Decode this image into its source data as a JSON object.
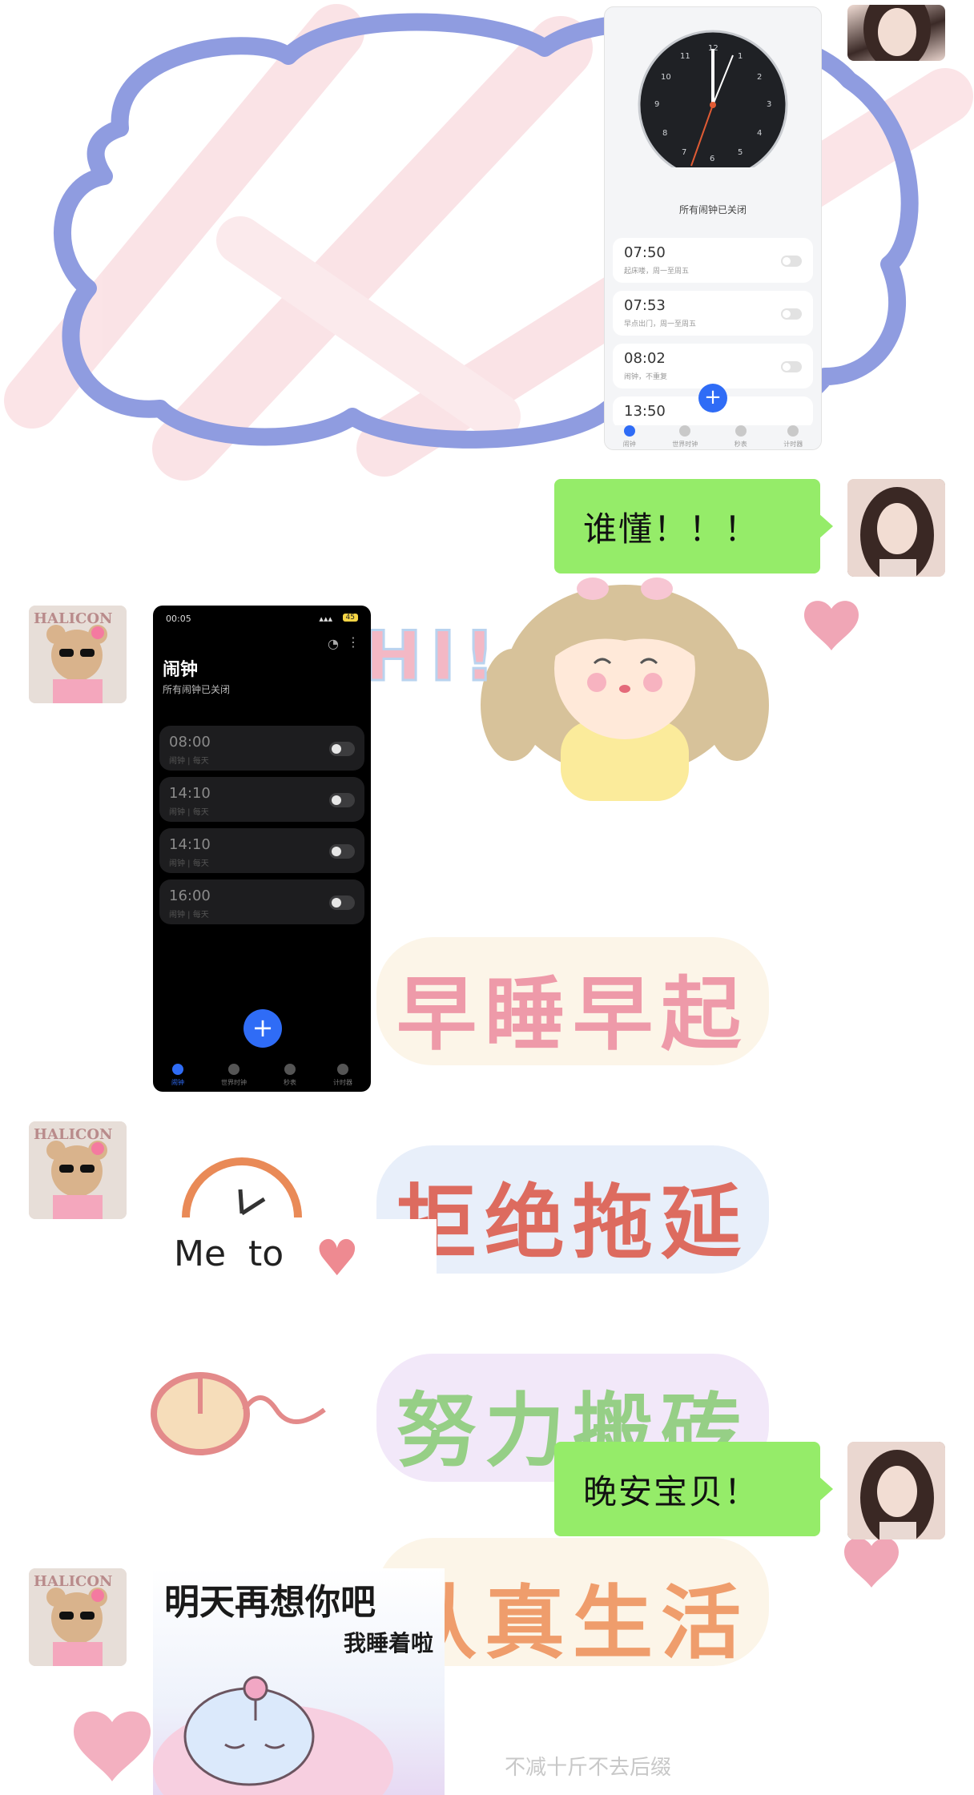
{
  "chat": {
    "messages": [
      {
        "from": "me",
        "type": "image",
        "name": "light-clock-screenshot"
      },
      {
        "from": "me",
        "type": "text",
        "text": "谁懂！！！"
      },
      {
        "from": "other",
        "type": "image",
        "name": "dark-clock-screenshot"
      },
      {
        "from": "other",
        "type": "sticker",
        "name": "morning-sticker"
      },
      {
        "from": "me",
        "type": "text",
        "text": "晚安宝贝！"
      },
      {
        "from": "other",
        "type": "sticker",
        "name": "goodnight-sticker"
      }
    ]
  },
  "bubbles": {
    "msg1": "谁懂！！！",
    "msg2": "晚安宝贝！"
  },
  "light_phone": {
    "caption": "所有闹钟已关闭",
    "dial_numbers": [
      "12",
      "1",
      "2",
      "3",
      "4",
      "5",
      "6",
      "7",
      "8",
      "9",
      "10",
      "11"
    ],
    "alarms": [
      {
        "time": "07:50",
        "sub": "起床喽，周一至周五"
      },
      {
        "time": "07:53",
        "sub": "早点出门，周一至周五"
      },
      {
        "time": "08:02",
        "sub": "闹钟，不重复"
      },
      {
        "time": "13:50",
        "sub": ""
      }
    ],
    "tabs": [
      "闹钟",
      "世界时钟",
      "秒表",
      "计时器"
    ]
  },
  "dark_phone": {
    "status_time": "00:05",
    "battery": "45",
    "title": "闹钟",
    "subtitle": "所有闹钟已关闭",
    "alarms": [
      {
        "time": "08:00",
        "sub": "闹钟 | 每天"
      },
      {
        "time": "14:10",
        "sub": "闹钟 | 每天"
      },
      {
        "time": "14:10",
        "sub": "闹钟 | 每天"
      },
      {
        "time": "16:00",
        "sub": "闹钟 | 每天"
      }
    ],
    "fab": "+",
    "tabs": [
      "闹钟",
      "世界时钟",
      "秒表",
      "计时器"
    ]
  },
  "sticker_big": {
    "hi": "HI!",
    "line1": "早睡早起",
    "line2": "拒绝拖延",
    "line3": "努力搬砖",
    "line4": "认真生活",
    "me_to": "Me  to"
  },
  "sticker_goodnight": {
    "line1": "明天再想你吧",
    "line2": "我睡着啦"
  },
  "watermark": "不减十斤不去后缀",
  "colors": {
    "bubble": "#95ec69",
    "cloud": "#8f9ce0",
    "pink": "#f5c2cb",
    "fab": "#2f6cf6"
  }
}
